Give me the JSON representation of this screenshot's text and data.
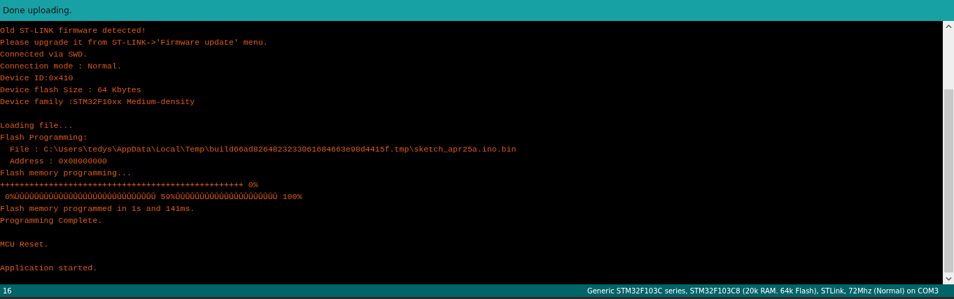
{
  "message_bar": {
    "text": "Done uploading."
  },
  "console": {
    "blocks": [
      [
        "Old ST-LINK firmware detected!",
        "Please upgrade it from ST-LINK->'Firmware update' menu.",
        "Connected via SWD.",
        "Connection mode : Normal.",
        "Device ID:0x410",
        "Device flash Size : 64 Kbytes",
        "Device family :STM32F10xx Medium-density"
      ],
      [
        "Loading file...",
        "Flash Programming:",
        "  File : C:\\Users\\tedys\\AppData\\Local\\Temp\\build66ad8264823233061684663e98d4415f.tmp\\sketch_apr25a.ino.bin",
        "  Address : 0x08000000",
        "Flash memory programming...",
        "++++++++++++++++++++++++++++++++++++++++++++++++++ 0%",
        " 0%ÛÛÛÛÛÛÛÛÛÛÛÛÛÛÛÛÛÛÛÛÛÛÛÛÛÛÛÛÛ 59%ÛÛÛÛÛÛÛÛÛÛÛÛÛÛÛÛÛÛÛÛÛ 100%",
        "Flash memory programmed in 1s and 141ms.",
        "Programming Complete."
      ],
      [
        "MCU Reset."
      ],
      [
        "Application started."
      ]
    ]
  },
  "status_bar": {
    "line_number": "16",
    "board": "Generic STM32F103C series, STM32F103C8 (20k RAM. 64k Flash), STLink, 72Mhz (Normal) on COM3"
  }
}
